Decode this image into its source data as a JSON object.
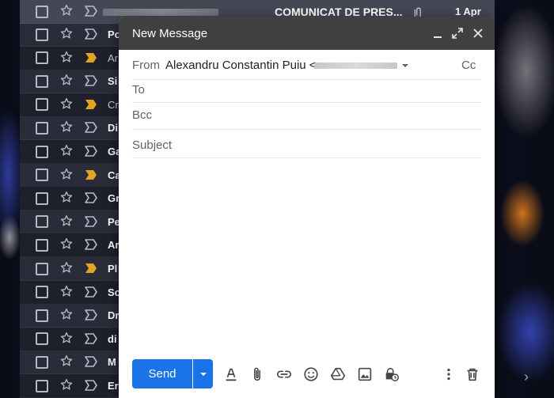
{
  "inbox": {
    "top_row": {
      "subject": "COMUNICAT DE PRES...",
      "date": "1 Apr",
      "attachment_icon": "paperclip-icon"
    },
    "rows": [
      {
        "sender": "Po",
        "important": false,
        "read": false
      },
      {
        "sender": "Ar",
        "important": true,
        "read": true
      },
      {
        "sender": "Si",
        "important": false,
        "read": false
      },
      {
        "sender": "Cr",
        "important": true,
        "read": true
      },
      {
        "sender": "Di",
        "important": false,
        "read": false
      },
      {
        "sender": "Ga",
        "important": false,
        "read": false
      },
      {
        "sender": "Ca",
        "important": true,
        "read": false
      },
      {
        "sender": "Gr",
        "important": false,
        "read": false
      },
      {
        "sender": "Pe",
        "important": false,
        "read": false
      },
      {
        "sender": "Ar",
        "important": false,
        "read": false
      },
      {
        "sender": "Pl",
        "important": true,
        "read": false
      },
      {
        "sender": "So",
        "important": false,
        "read": false
      },
      {
        "sender": "Dr",
        "important": false,
        "read": false
      },
      {
        "sender": "di",
        "important": false,
        "read": false
      },
      {
        "sender": "M",
        "important": false,
        "read": false
      },
      {
        "sender": "Er",
        "important": false,
        "read": false
      }
    ]
  },
  "compose": {
    "title": "New Message",
    "header_icons": [
      "minimize-icon",
      "expand-icon",
      "close-icon"
    ],
    "from_label": "From",
    "from_value": "Alexandru Constantin Puiu <",
    "cc_label": "Cc",
    "to_label": "To",
    "bcc_label": "Bcc",
    "subject_placeholder": "Subject",
    "send_label": "Send",
    "toolbar_icons": [
      "text-format-icon",
      "paperclip-icon",
      "link-icon",
      "emoji-icon",
      "drive-icon",
      "image-icon",
      "confidential-icon",
      "more-vert-icon",
      "trash-icon"
    ]
  },
  "colors": {
    "send_button": "#1a73e8",
    "compose_header": "#404040",
    "important_marker": "#e2a523"
  }
}
